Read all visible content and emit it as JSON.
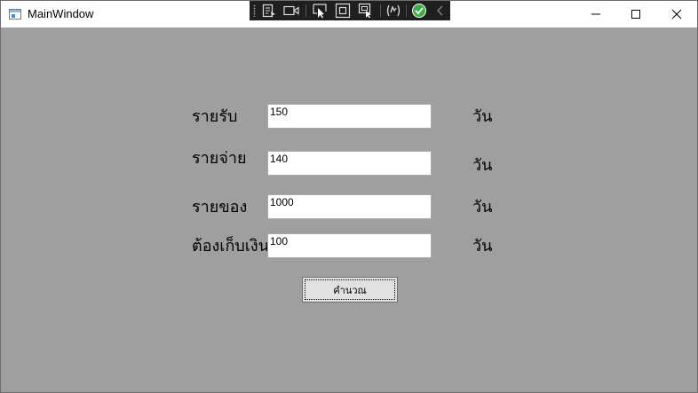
{
  "window": {
    "title": "MainWindow"
  },
  "devtools": {
    "icons": [
      "live-visual-tree-icon",
      "video-record-icon",
      "select-element-icon",
      "display-layout-adorners-icon",
      "track-focus-icon",
      "hot-reload-icon",
      "binding-check-icon",
      "collapse-chevron-icon"
    ]
  },
  "form": {
    "rows": [
      {
        "label": "รายรับ",
        "value": "150",
        "unit": "วัน"
      },
      {
        "label": "รายจ่าย",
        "value": "140",
        "unit": "วัน"
      },
      {
        "label": "รายของ",
        "value": "1000",
        "unit": "วัน"
      },
      {
        "label": "ต้องเก็บเงิน",
        "value": "100",
        "unit": "วัน"
      }
    ],
    "calculate_label": "คำนวณ"
  },
  "colors": {
    "client_bg": "#9f9f9f",
    "titlebar_bg": "#ffffff",
    "devbar_bg": "#1f1f1f",
    "check_green": "#3fae49"
  }
}
